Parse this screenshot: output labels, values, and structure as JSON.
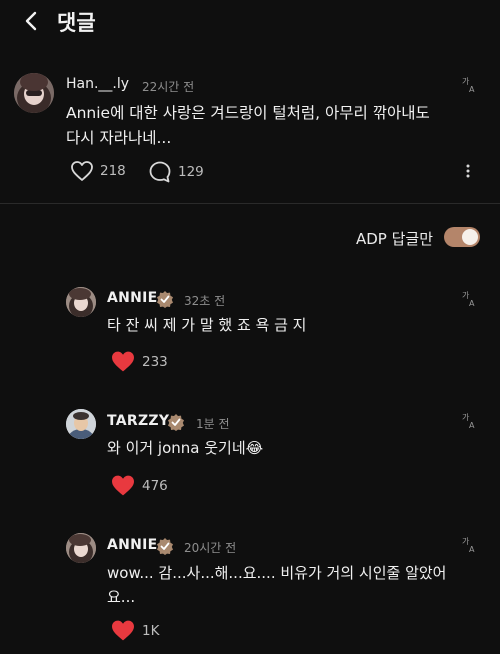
{
  "header": {
    "title": "댓글"
  },
  "main_comment": {
    "username": "Han.__.ly",
    "time": "22시간 전",
    "text": "Annie에 대한 사랑은 겨드랑이 털처럼, 아무리 깎아내도 다시 자라나네...",
    "likes": "218",
    "replies": "129"
  },
  "filter": {
    "label": "ADP 답글만",
    "enabled": true,
    "color": "#b4856a"
  },
  "replies": [
    {
      "username": "ANNIE",
      "time": "32초 전",
      "text": "타 잔 씨 제 가 말 했 죠 욕 금 지",
      "likes": "233"
    },
    {
      "username": "TARZZY",
      "time": "1분 전",
      "text": "와 이거 jonna 웃기네😂",
      "likes": "476"
    },
    {
      "username": "ANNIE",
      "time": "20시간 전",
      "text": "wow... 감...사...해...요.... 비유가 거의 시인줄 알았어요...",
      "likes": "1K"
    }
  ],
  "colors": {
    "like_red": "#e8393f",
    "background": "#0f0f0f"
  }
}
